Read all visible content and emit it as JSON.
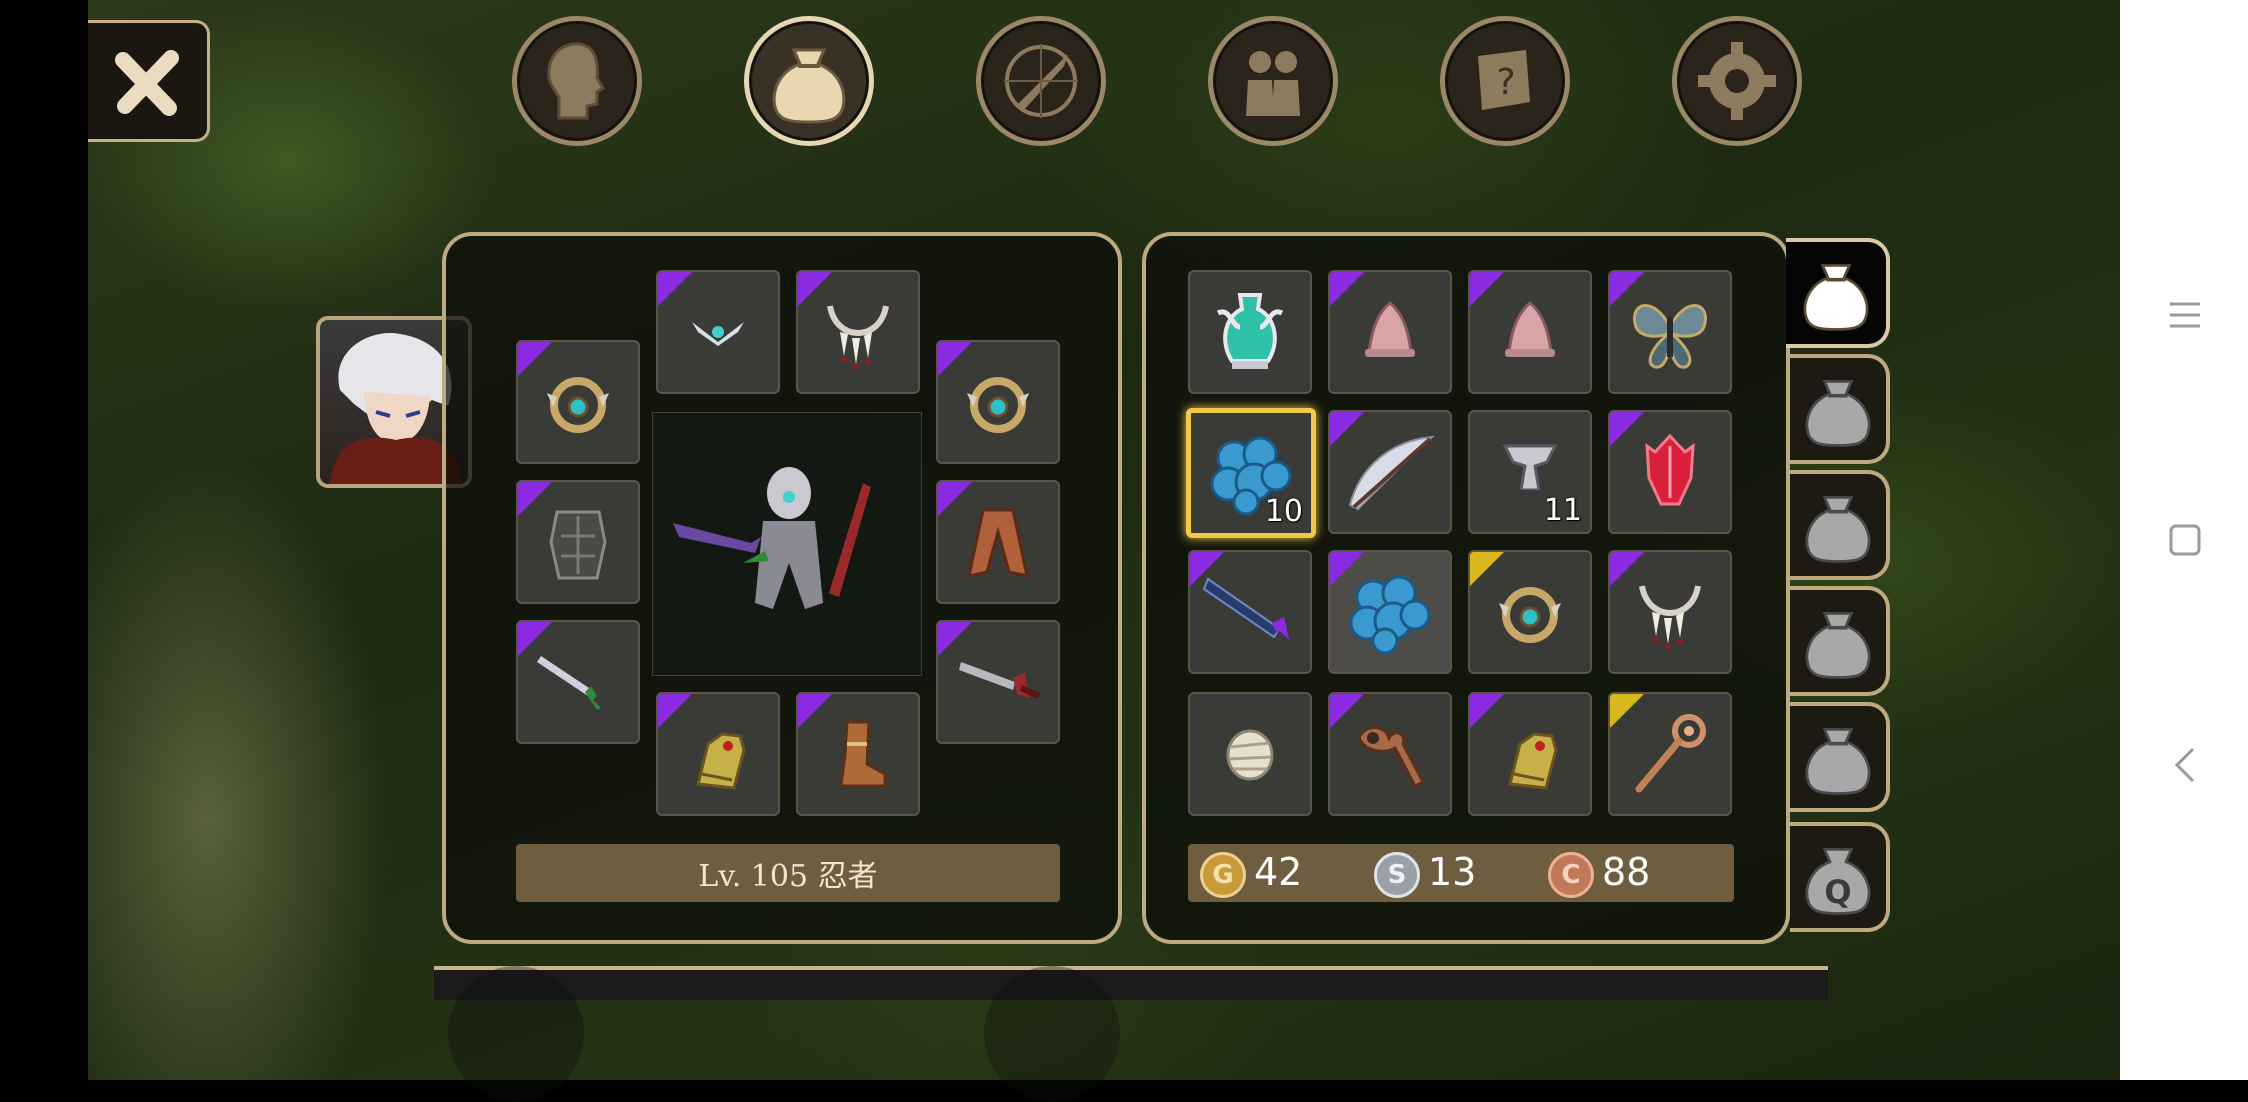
{
  "top_tabs": [
    {
      "name": "character-tab",
      "icon": "head-icon",
      "active": false
    },
    {
      "name": "inventory-tab",
      "icon": "bag-icon",
      "active": true
    },
    {
      "name": "skills-tab",
      "icon": "sword-compass-icon",
      "active": false
    },
    {
      "name": "party-tab",
      "icon": "people-icon",
      "active": false
    },
    {
      "name": "quest-tab",
      "icon": "scroll-icon",
      "active": false
    },
    {
      "name": "settings-tab",
      "icon": "gear-icon",
      "active": false
    }
  ],
  "equipment": {
    "level_label": "Lv. 105 忍者",
    "slots": [
      {
        "slot": "head",
        "icon": "tiara-icon",
        "rarity": "purple"
      },
      {
        "slot": "necklace",
        "icon": "fang-necklace-icon",
        "rarity": "purple"
      },
      {
        "slot": "ring-left",
        "icon": "gem-ring-icon",
        "rarity": "purple"
      },
      {
        "slot": "ring-right",
        "icon": "gem-ring-icon",
        "rarity": "purple"
      },
      {
        "slot": "armor",
        "icon": "dark-armor-icon",
        "rarity": "purple"
      },
      {
        "slot": "cloak",
        "icon": "cloak-icon",
        "rarity": "purple"
      },
      {
        "slot": "main-hand",
        "icon": "green-sword-icon",
        "rarity": "purple"
      },
      {
        "slot": "off-hand",
        "icon": "red-sword-icon",
        "rarity": "purple"
      },
      {
        "slot": "gloves",
        "icon": "gauntlet-icon",
        "rarity": "purple"
      },
      {
        "slot": "boots",
        "icon": "boots-icon",
        "rarity": "purple"
      }
    ]
  },
  "inventory": {
    "items": [
      {
        "icon": "potion-vase-icon",
        "rarity": "none",
        "qty": ""
      },
      {
        "icon": "pink-hat-icon",
        "rarity": "purple",
        "qty": ""
      },
      {
        "icon": "pink-hat-icon",
        "rarity": "purple",
        "qty": ""
      },
      {
        "icon": "butterfly-icon",
        "rarity": "purple",
        "qty": ""
      },
      {
        "icon": "blue-ore-icon",
        "rarity": "none",
        "qty": "10",
        "selected": true
      },
      {
        "icon": "feather-bow-icon",
        "rarity": "purple",
        "qty": ""
      },
      {
        "icon": "anvil-icon",
        "rarity": "none",
        "qty": "11"
      },
      {
        "icon": "red-crystal-icon",
        "rarity": "purple",
        "qty": ""
      },
      {
        "icon": "dark-blade-icon",
        "rarity": "purple",
        "qty": ""
      },
      {
        "icon": "blue-ore-icon",
        "rarity": "purple",
        "qty": "",
        "highlight": true
      },
      {
        "icon": "gem-ring-icon",
        "rarity": "gold",
        "qty": ""
      },
      {
        "icon": "fang-necklace-icon",
        "rarity": "purple",
        "qty": ""
      },
      {
        "icon": "bandage-icon",
        "rarity": "none",
        "qty": ""
      },
      {
        "icon": "bone-staff-icon",
        "rarity": "purple",
        "qty": ""
      },
      {
        "icon": "gauntlet-icon",
        "rarity": "purple",
        "qty": ""
      },
      {
        "icon": "copper-staff-icon",
        "rarity": "gold",
        "qty": ""
      }
    ],
    "currency": {
      "gold": {
        "symbol": "G",
        "value": "42"
      },
      "silver": {
        "symbol": "S",
        "value": "13"
      },
      "copper": {
        "symbol": "C",
        "value": "88"
      }
    },
    "quest_bag_label": "Q"
  },
  "colors": {
    "purple": "#8a2be2",
    "gold": "#d8b81c",
    "frame": "#bfa97f"
  }
}
